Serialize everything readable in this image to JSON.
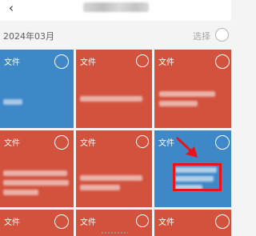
{
  "header": {
    "back_icon": "chevron-left-icon",
    "back_glyph": "‹"
  },
  "group": {
    "date": "2024年03月",
    "select_label": "选择"
  },
  "tiles": [
    {
      "label": "文件",
      "color": "blue"
    },
    {
      "label": "文件",
      "color": "red"
    },
    {
      "label": "文件",
      "color": "red"
    },
    {
      "label": "文件",
      "color": "red"
    },
    {
      "label": "文件",
      "color": "red"
    },
    {
      "label": "文件",
      "color": "blue"
    },
    {
      "label": "文件",
      "color": "red"
    },
    {
      "label": "文件",
      "color": "red"
    },
    {
      "label": "文件",
      "color": "red"
    }
  ],
  "colors": {
    "tile_red": "#d2523e",
    "tile_blue": "#3e88c8",
    "annotation_red": "#e8141c"
  }
}
